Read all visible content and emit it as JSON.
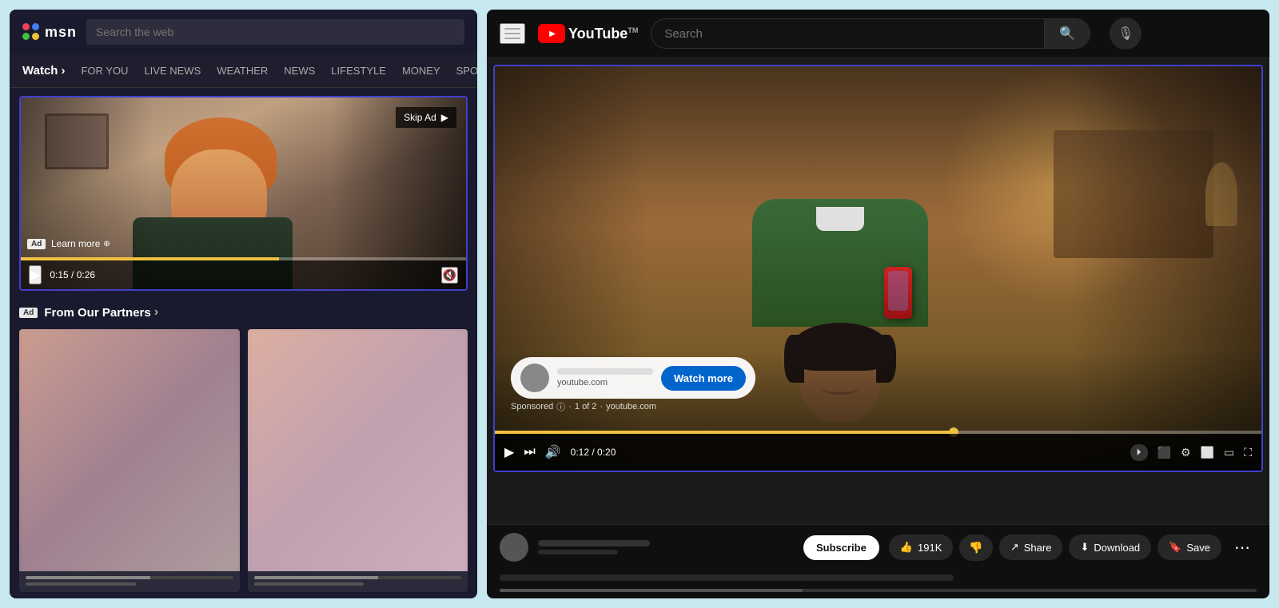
{
  "msn": {
    "logo_text": "msn",
    "search_placeholder": "Search the web",
    "nav": {
      "watch_label": "Watch",
      "chevron": "›",
      "items": [
        "FOR YOU",
        "LIVE NEWS",
        "WEATHER",
        "NEWS",
        "LIFESTYLE",
        "MONEY",
        "SPORTS"
      ]
    },
    "video": {
      "ad_badge": "Ad",
      "learn_more": "Learn more",
      "skip_label": "Skip Ad",
      "time_current": "0:15",
      "time_total": "0:26"
    },
    "partners": {
      "ad_badge": "Ad",
      "title": "From Our Partners",
      "chevron": "›"
    }
  },
  "youtube": {
    "search_placeholder": "Search",
    "logo_text": "YouTube",
    "logo_tm": "TM",
    "ad_overlay": {
      "domain": "youtube.com",
      "watch_more_label": "Watch more"
    },
    "sponsored_text": "Sponsored",
    "info_icon": "ⓘ",
    "ad_count": "1 of 2",
    "ad_domain2": "youtube.com",
    "controls": {
      "time_current": "0:12",
      "time_total": "0:20"
    },
    "bottom": {
      "subscribe_label": "Subscribe",
      "like_count": "191K",
      "share_label": "Share",
      "download_label": "Download",
      "save_label": "Save"
    }
  }
}
